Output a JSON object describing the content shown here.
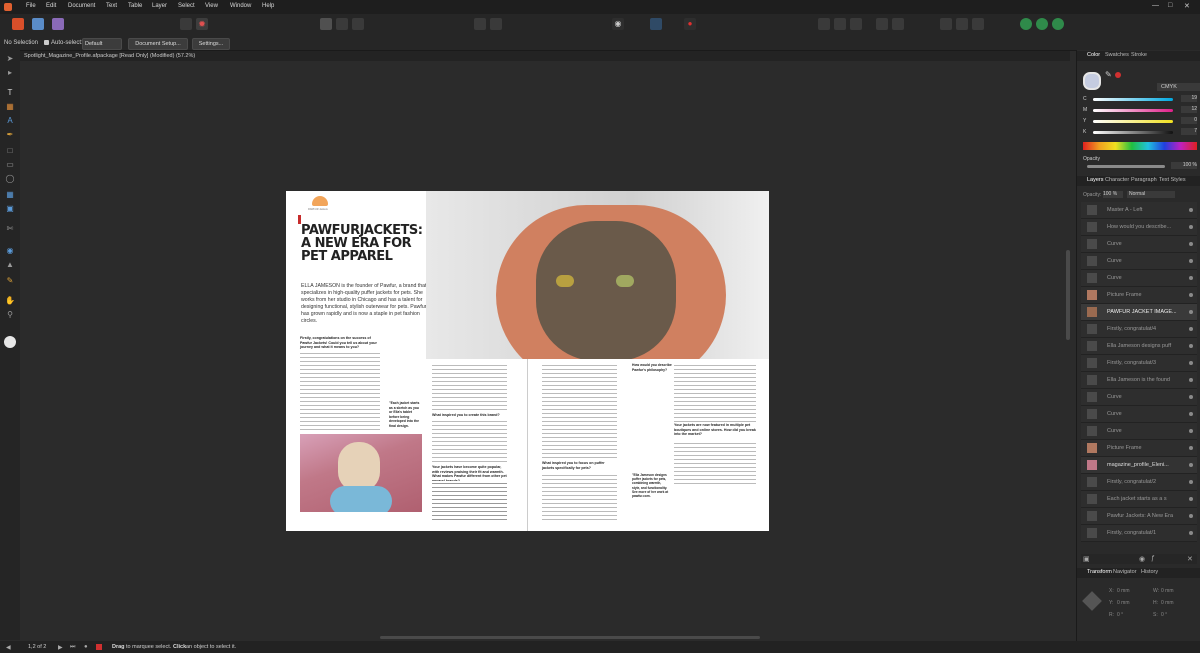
{
  "menu": {
    "items": [
      "File",
      "Edit",
      "Document",
      "Text",
      "Table",
      "Layer",
      "Select",
      "View",
      "Window",
      "Help"
    ]
  },
  "context": {
    "selection": "No Selection",
    "auto_select": "Auto-select:",
    "auto_select_value": "Default",
    "doc_setup": "Document Setup...",
    "settings": "Settings..."
  },
  "tab": {
    "title": "Spotlight_Magazine_Profile.afpackage [Read Only] (Modified) (57.2%)"
  },
  "color_panel": {
    "tabs": [
      "Color",
      "Swatches",
      "Stroke"
    ],
    "model": "CMYK",
    "c_label": "C",
    "c_value": "19",
    "m_label": "M",
    "m_value": "12",
    "y_label": "Y",
    "y_value": "0",
    "k_label": "K",
    "k_value": "7",
    "opacity_label": "Opacity",
    "opacity_value": "100 %"
  },
  "layers_panel": {
    "tabs": [
      "Layers",
      "Character",
      "Paragraph",
      "Text Styles"
    ],
    "opacity_label": "Opacity:",
    "opacity_value": "100 %",
    "blend": "Normal",
    "rows": [
      "Master A - Left",
      "How would you describe...",
      "Curve",
      "Curve",
      "Curve",
      "Picture Frame",
      "PAWFUR JACKET IMAGE...",
      "Firstly, congratulat/4",
      "Ella Jameson designs puff",
      "Firstly, congratulat/3",
      "Ella Jameson is the found",
      "Curve",
      "Curve",
      "Curve",
      "Picture Frame",
      "magazine_profile_Eleni...",
      "Firstly, congratulat/2",
      "Each jacket starts as a s",
      "Pawfur Jackets: A New Era",
      "Firstly, congratulat/1"
    ]
  },
  "transform_panel": {
    "tabs": [
      "Transform",
      "Navigator",
      "History"
    ],
    "x_label": "X:",
    "x_value": "0 mm",
    "y_label": "Y:",
    "y_value": "0 mm",
    "w_label": "W:",
    "w_value": "0 mm",
    "h_label": "H:",
    "h_value": "0 mm",
    "r_label": "R:",
    "r_value": "0 °",
    "s_label": "S:",
    "s_value": "0 °"
  },
  "status": {
    "page": "1,2 of 2",
    "hint_drag": "Drag",
    "hint_a": "to marquee select.",
    "hint_click": "Click",
    "hint_b": "an object to select it."
  },
  "spread": {
    "logo_text": "PAWFUR Jackets",
    "headline": "PAWFURJACKETS: A NEW ERA FOR PET APPAREL",
    "intro": "ELLA JAMESON is the founder of Pawfur, a brand that specializes in high-quality puffer jackets for pets. She works from her studio in Chicago and has a talent for designing functional, stylish outerwear for pets. Pawfur has grown rapidly and is now a staple in pet fashion circles.",
    "q1": "Firstly, congratulations on the success of Pawfur Jackets! Could you tell us about your journey and what it means to you?",
    "pullquote": "\"Each jacket starts as a sketch as you or Ella's tablet before being developed into the final design.",
    "q2": "What inspired you to create this brand?",
    "q3": "Your jackets have become quite popular, with reviews praising their fit and warmth. What makes Pawfur different from other pet apparel brands?",
    "q4": "What inspired you to focus on puffer jackets specifically for pets?",
    "q5": "How would you describe Pawfur's philosophy?",
    "q6": "Your jackets are now featured in multiple pet boutiques and online stores. How did you break into the market?",
    "pullquote2": "\"Ella Jameson designs puffer jackets for pets, combining warmth, style, and functionality. See more of her work at pawfur.com."
  }
}
